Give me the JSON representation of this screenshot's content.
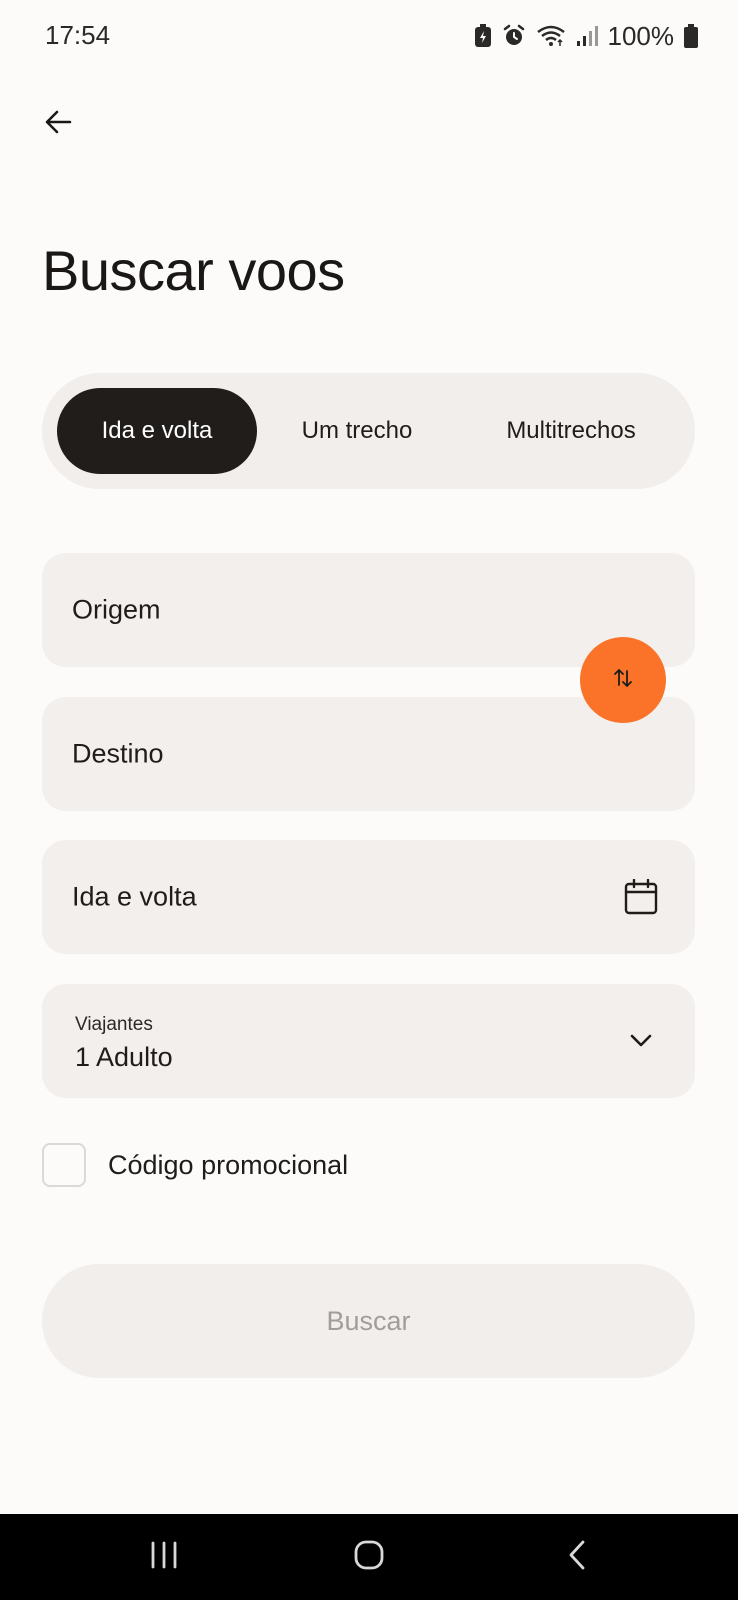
{
  "status_bar": {
    "time": "17:54",
    "battery_percent": "100%",
    "icons": [
      "battery-saver-icon",
      "alarm-icon",
      "wifi-icon",
      "signal-icon",
      "battery-icon"
    ]
  },
  "header": {
    "back_icon": "arrow-left-icon",
    "title": "Buscar voos"
  },
  "trip_type": {
    "options": [
      {
        "label": "Ida e volta",
        "selected": true
      },
      {
        "label": "Um trecho",
        "selected": false
      },
      {
        "label": "Multitrechos",
        "selected": false
      }
    ]
  },
  "form": {
    "origin_placeholder": "Origem",
    "destination_placeholder": "Destino",
    "swap_icon": "swap-vertical-icon",
    "dates_placeholder": "Ida e volta",
    "calendar_icon": "calendar-icon",
    "travelers_label": "Viajantes",
    "travelers_value": "1 Adulto",
    "travelers_icon": "chevron-down-icon",
    "promo_label": "Código promocional",
    "promo_checked": false
  },
  "actions": {
    "search_label": "Buscar",
    "search_enabled": false
  },
  "colors": {
    "accent": "#fa7328",
    "selected_tab": "#211d1b",
    "field_bg": "#f2efed",
    "page_bg": "#fcfbfa"
  },
  "nav_bar": {
    "icons": [
      "recents-icon",
      "home-icon",
      "back-icon"
    ]
  }
}
